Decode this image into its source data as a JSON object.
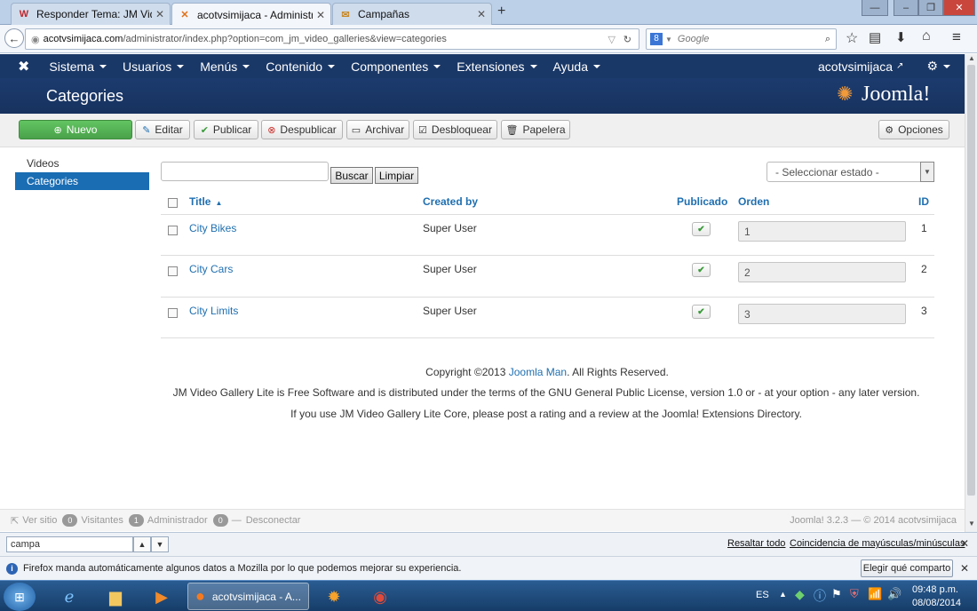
{
  "browser": {
    "tabs": [
      {
        "label": "Responder Tema: JM Video ...",
        "icon": "wp-icon",
        "icon_glyph": "W",
        "active": false
      },
      {
        "label": "acotvsimijaca - Administra...",
        "icon": "joomla-icon",
        "icon_glyph": "✕",
        "active": true
      },
      {
        "label": "Campañas",
        "icon": "mail-icon",
        "icon_glyph": "✉",
        "active": false
      }
    ],
    "new_tab_glyph": "+",
    "url_domain": "acotvsimijaca.com",
    "url_rest": "/administrator/index.php?option=com_jm_video_galleries&view=categories",
    "search_placeholder": "Google"
  },
  "menu": {
    "items": [
      "Sistema",
      "Usuarios",
      "Menús",
      "Contenido",
      "Componentes",
      "Extensiones",
      "Ayuda"
    ],
    "site_name": "acotvsimijaca",
    "logo_text": "Joomla!"
  },
  "header": {
    "title": "Categories"
  },
  "toolbar": {
    "new": "Nuevo",
    "edit": "Editar",
    "publish": "Publicar",
    "unpublish": "Despublicar",
    "archive": "Archivar",
    "unlock": "Desbloquear",
    "trash": "Papelera",
    "options": "Opciones"
  },
  "sidebar": {
    "items": [
      "Videos",
      "Categories"
    ],
    "active": "Categories"
  },
  "filter": {
    "search_value": "",
    "search_button": "Buscar",
    "clear_button": "Limpiar",
    "state_select": "- Seleccionar estado -"
  },
  "table": {
    "headers": {
      "title": "Title",
      "created_by": "Created by",
      "published": "Publicado",
      "order": "Orden",
      "id": "ID"
    },
    "rows": [
      {
        "title": "City Bikes",
        "created_by": "Super User",
        "published": true,
        "order": "1",
        "id": "1"
      },
      {
        "title": "City Cars",
        "created_by": "Super User",
        "published": true,
        "order": "2",
        "id": "2"
      },
      {
        "title": "City Limits",
        "created_by": "Super User",
        "published": true,
        "order": "3",
        "id": "3"
      }
    ]
  },
  "footer": {
    "copyright_pre": "Copyright ©2013",
    "copyright_link": "Joomla Man",
    "copyright_post": ". All Rights Reserved.",
    "line2": "JM Video Gallery Lite is Free Software and is distributed under the terms of the GNU General Public License, version 1.0 or - at your option - any later version.",
    "line3": "If you use JM Video Gallery Lite Core, please post a rating and a review at the Joomla! Extensions Directory."
  },
  "status": {
    "view_site": "Ver sitio",
    "visitors_count": "0",
    "visitors": "Visitantes",
    "admin_count": "1",
    "admin": "Administrador",
    "logout_count": "0",
    "logout": "Desconectar",
    "version": "Joomla! 3.2.3 — © 2014 acotvsimijaca"
  },
  "findbar": {
    "value": "campa",
    "highlight_all": "Resaltar todo",
    "match_case": "Coincidencia de mayúsculas/minúsculas"
  },
  "notification": {
    "text": "Firefox manda automáticamente algunos datos a Mozilla por lo que podemos mejorar su experiencia.",
    "button": "Elegir qué comparto"
  },
  "taskbar": {
    "active_window": "acotvsimijaca - A...",
    "lang": "ES",
    "time": "09:48 p.m.",
    "date": "08/08/2014"
  }
}
